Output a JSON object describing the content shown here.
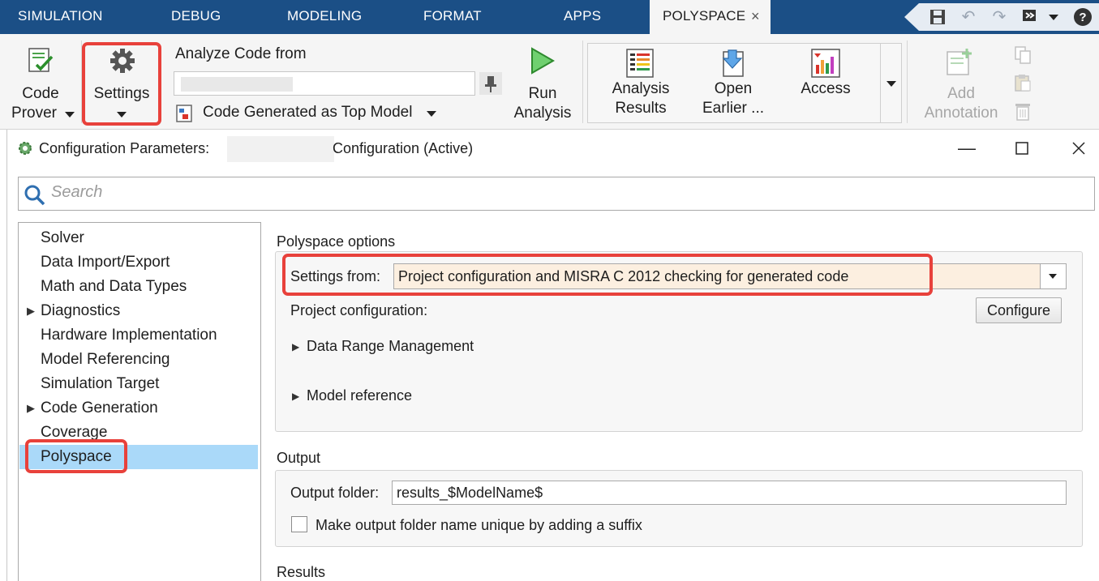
{
  "tabs": [
    {
      "label": "SIMULATION"
    },
    {
      "label": "DEBUG"
    },
    {
      "label": "MODELING"
    },
    {
      "label": "FORMAT"
    },
    {
      "label": "APPS"
    },
    {
      "label": "POLYSPACE"
    }
  ],
  "tab_close": "×",
  "ribbon": {
    "code_prover": {
      "line1": "Code",
      "line2": "Prover"
    },
    "settings": {
      "label": "Settings"
    },
    "analyze_from": {
      "label": "Analyze Code from",
      "value": ""
    },
    "code_generated": {
      "label": "Code Generated as Top Model"
    },
    "run_analysis": {
      "line1": "Run",
      "line2": "Analysis"
    },
    "analysis_results": {
      "line1": "Analysis",
      "line2": "Results"
    },
    "open_earlier": {
      "line1": "Open",
      "line2": "Earlier ..."
    },
    "access": {
      "label": "Access"
    },
    "add_annotation": {
      "line1": "Add",
      "line2": "Annotation"
    }
  },
  "dialog": {
    "title_prefix": "Configuration Parameters:",
    "title_suffix": "Configuration (Active)",
    "search_placeholder": "Search",
    "tree": [
      {
        "label": "Solver"
      },
      {
        "label": "Data Import/Export"
      },
      {
        "label": "Math and Data Types"
      },
      {
        "label": "Diagnostics"
      },
      {
        "label": "Hardware Implementation"
      },
      {
        "label": "Model Referencing"
      },
      {
        "label": "Simulation Target"
      },
      {
        "label": "Code Generation"
      },
      {
        "label": "Coverage"
      },
      {
        "label": "Polyspace"
      }
    ],
    "polyspace_options": {
      "title": "Polyspace options",
      "settings_from_label": "Settings from:",
      "settings_from_value": "Project configuration and MISRA C 2012 checking for generated code",
      "project_config_label": "Project configuration:",
      "configure_button": "Configure",
      "data_range": "Data Range Management",
      "model_reference": "Model reference"
    },
    "output": {
      "title": "Output",
      "folder_label": "Output folder:",
      "folder_value": "results_$ModelName$",
      "unique_label": "Make output folder name unique by adding a suffix",
      "unique_checked": false
    },
    "results": {
      "title": "Results"
    }
  },
  "colors": {
    "tabbar": "#1b4f86",
    "highlight": "#e8413b",
    "selection": "#aad9f9"
  },
  "icons": [
    "code-prover-icon",
    "gear-icon",
    "pin-icon",
    "run-icon",
    "analysis-results-icon",
    "open-earlier-icon",
    "access-icon",
    "add-annotation-icon",
    "search-icon",
    "settings-icon",
    "save-icon",
    "undo-icon",
    "redo-icon",
    "help-icon"
  ]
}
